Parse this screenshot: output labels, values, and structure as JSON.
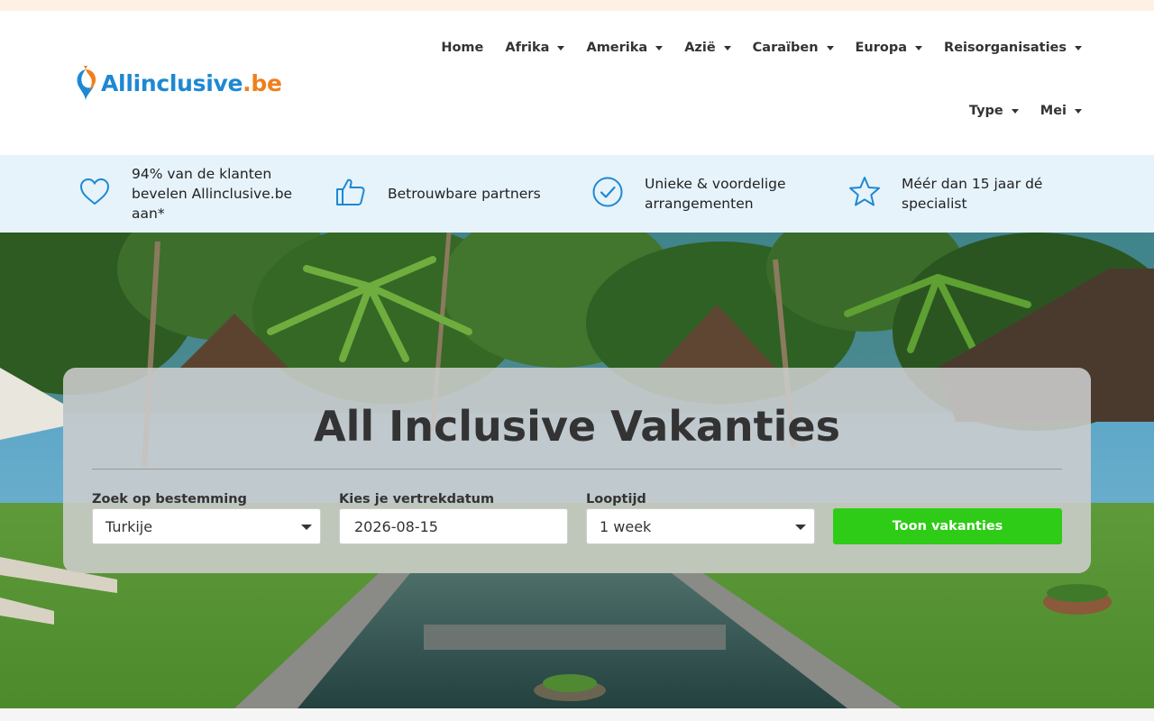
{
  "brand": {
    "logo_part1": "Allinclusive",
    "logo_part2": ".be",
    "primary_color": "#1e88d2",
    "accent_color": "#f07f1b"
  },
  "nav": {
    "items": [
      {
        "label": "Home",
        "dropdown": false
      },
      {
        "label": "Afrika",
        "dropdown": true
      },
      {
        "label": "Amerika",
        "dropdown": true
      },
      {
        "label": "Azië",
        "dropdown": true
      },
      {
        "label": "Caraïben",
        "dropdown": true
      },
      {
        "label": "Europa",
        "dropdown": true
      },
      {
        "label": "Reisorganisaties",
        "dropdown": true
      },
      {
        "label": "Type",
        "dropdown": true
      },
      {
        "label": "Mei",
        "dropdown": true
      }
    ]
  },
  "usps": [
    {
      "icon": "heart-icon",
      "text": "94% van de klanten bevelen Allinclusive.be aan*"
    },
    {
      "icon": "thumbs-up-icon",
      "text": "Betrouwbare partners"
    },
    {
      "icon": "check-circle-icon",
      "text": "Unieke & voordelige arrangementen"
    },
    {
      "icon": "star-icon",
      "text": "Méér dan 15 jaar dé specialist"
    }
  ],
  "search": {
    "title": "All Inclusive Vakanties",
    "destination_label": "Zoek op bestemming",
    "destination_value": "Turkije",
    "date_label": "Kies je vertrekdatum",
    "date_value": "2026-08-15",
    "duration_label": "Looptijd",
    "duration_value": "1 week",
    "submit_label": "Toon vakanties",
    "submit_color": "#2ecc16"
  }
}
